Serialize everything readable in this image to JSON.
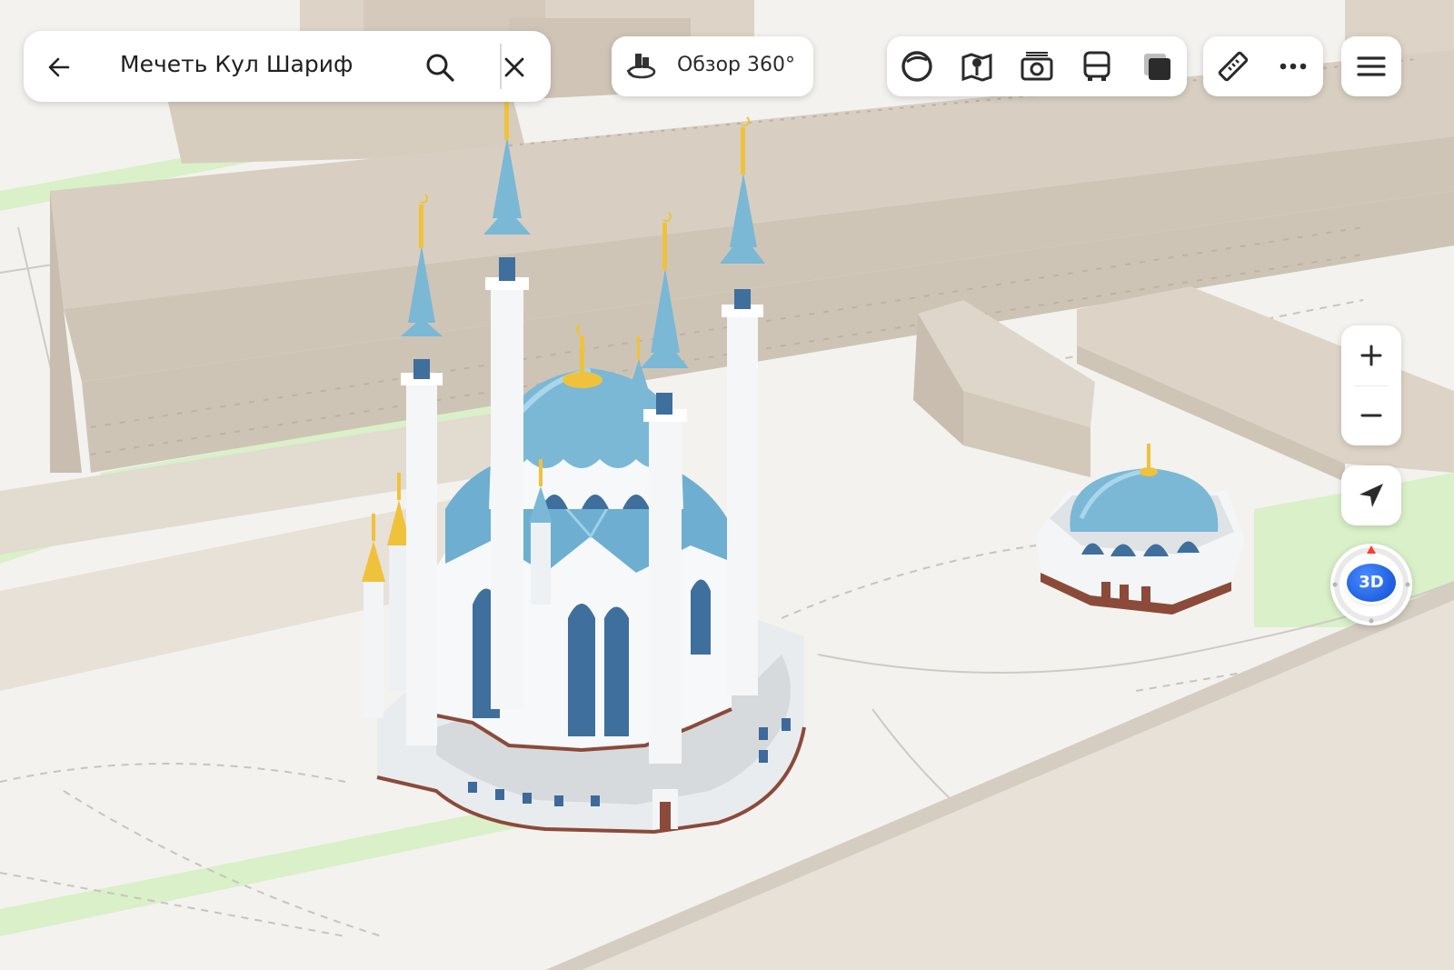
{
  "search": {
    "query": "Мечеть Кул Шариф"
  },
  "panorama": {
    "label": "Обзор 360°"
  },
  "layers": [
    {
      "name": "layer-circle-icon"
    },
    {
      "name": "layer-traffic-icon"
    },
    {
      "name": "layer-camera-icon"
    },
    {
      "name": "layer-transport-icon"
    },
    {
      "name": "layer-square-icon"
    }
  ],
  "tools": [
    "ruler-icon",
    "more-icon"
  ],
  "map_controls": {
    "mode_badge": "3D"
  },
  "colors": {
    "accent": "#2366ea",
    "dome": "#7ab8d6",
    "gold": "#f0c23b",
    "building": "#d8cfc2",
    "greenery": "#d9f0c9"
  }
}
